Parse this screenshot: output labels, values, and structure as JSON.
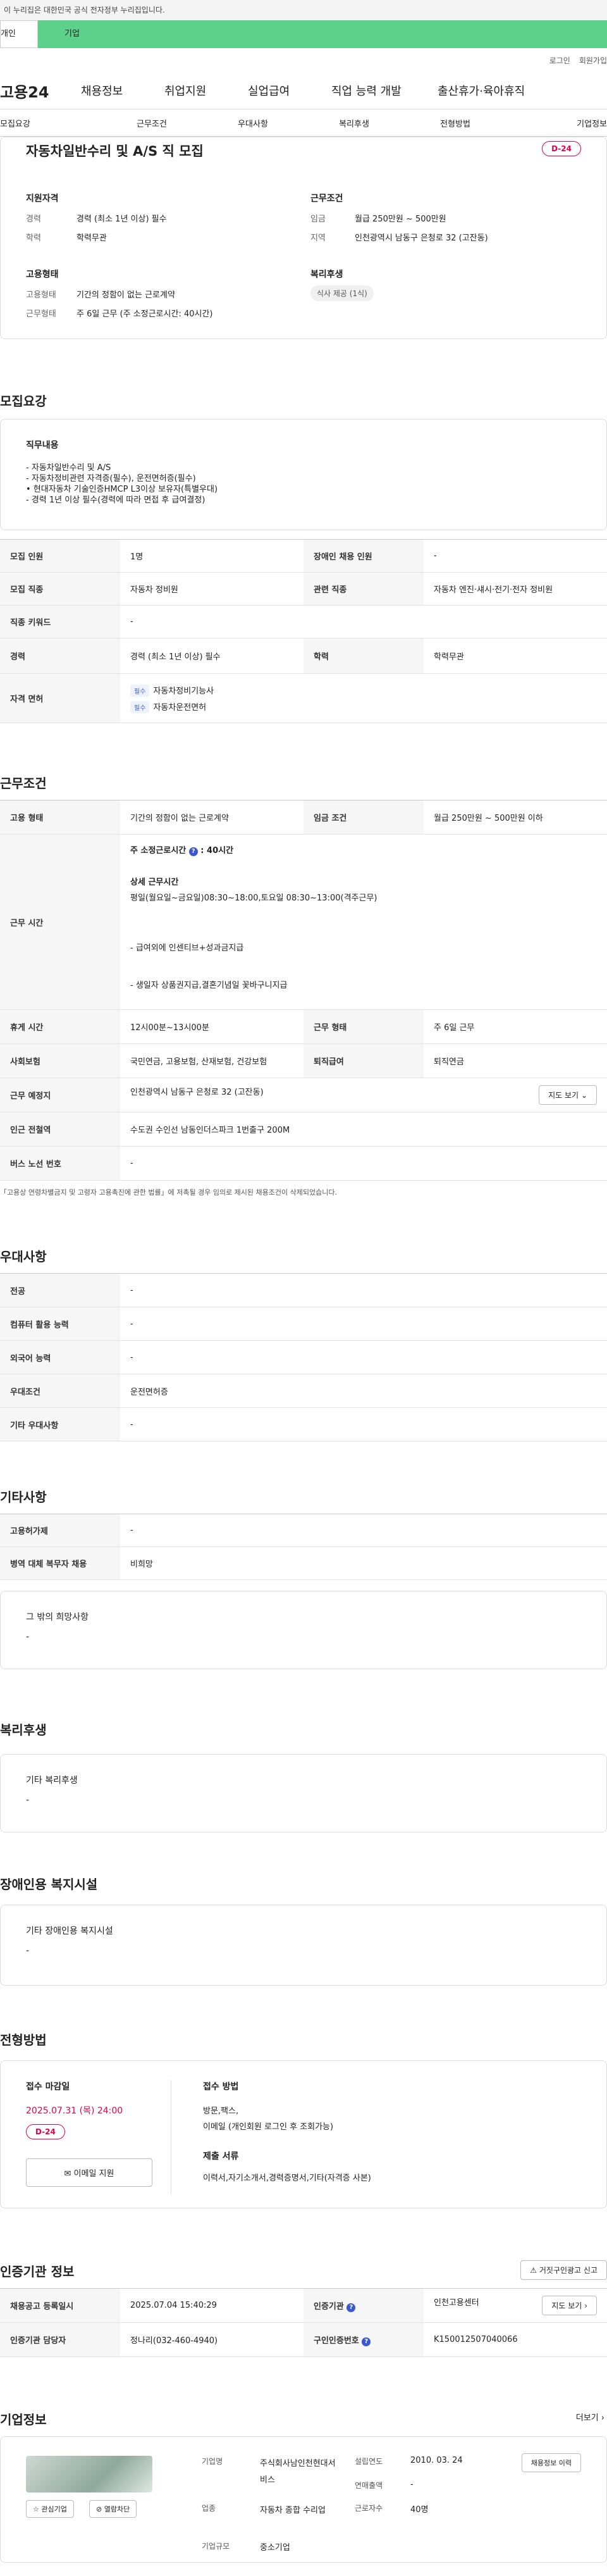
{
  "gov_banner": "이 누리집은 대한민국 공식 전자정부 누리집입니다.",
  "tabs": {
    "person": "개인",
    "business": "기업"
  },
  "util": {
    "login": "로그인",
    "join": "회원가입"
  },
  "logo": "고용24",
  "gnb": [
    "채용정보",
    "취업지원",
    "실업급여",
    "직업 능력 개발",
    "출산휴가·육아휴직"
  ],
  "tabbar": [
    "모집요강",
    "근무조건",
    "우대사항",
    "복리후생",
    "전형방법",
    "기업정보"
  ],
  "summary": {
    "title": "자동차일반수리 및 A/S 직 모집",
    "dday": "D-24",
    "qual_title": "지원자격",
    "career_label": "경력",
    "career": "경력 (최소 1년 이상) 필수",
    "edu_label": "학력",
    "edu": "학력무관",
    "cond_title": "근무조건",
    "wage_label": "임금",
    "wage": "월급 250만원 ~ 500만원",
    "region_label": "지역",
    "region": "인천광역시 남동구 은청로 32 (고잔동)",
    "emp_title": "고용형태",
    "emptype_label": "고용형태",
    "emptype": "기간의 정함이 없는 근로계약",
    "worktype_label": "근무형태",
    "worktype": "주 6일 근무 (주 소정근로시간: 40시간)",
    "welfare_title": "복리후생",
    "welfare_tag": "식사 제공 (1식)"
  },
  "recruit": {
    "title": "모집요강",
    "duty_title": "직무내용",
    "duty_lines": [
      "- 자동차일반수리 및 A/S",
      "- 자동차정비관련 자격증(필수), 운전면허증(필수)",
      "• 현대자동차 기술인증HMCP L3이상 보유자(특별우대)",
      "- 경력 1년 이상 필수(경력에 따라 면접 후 급여결정)"
    ],
    "rows": {
      "count_k": "모집 인원",
      "count_v": "1명",
      "dis_k": "장애인 채용 인원",
      "dis_v": "-",
      "job_k": "모집 직종",
      "job_v": "자동차 정비원",
      "rel_k": "관련 직종",
      "rel_v": "자동차 엔진·섀시·전기·전자 정비원",
      "kw_k": "직종 키워드",
      "kw_v": "-",
      "career_k": "경력",
      "career_v": "경력 (최소 1년 이상) 필수",
      "edu_k": "학력",
      "edu_v": "학력무관",
      "lic_k": "자격 면허",
      "lic_chip": "필수",
      "lic1": "자동차정비기능사",
      "lic2": "자동차운전면허"
    }
  },
  "work": {
    "title": "근무조건",
    "emp_k": "고용 형태",
    "emp_v": "기간의 정함이 없는 근로계약",
    "wage_k": "임금 조건",
    "wage_v": "월급 250만원 ~ 500만원 이하",
    "hours_k": "근무 시간",
    "hours_head": "주 소정근로시간",
    "hours_val": "40시간",
    "hours_sub": "상세 근무시간",
    "hours_detail": "평일(월요일~금요일)08:30~18:00,토요일 08:30~13:00(격주근무)",
    "extra1": "- 급여외에 인센티브+성과금지급",
    "extra2": "- 생일자 상품권지급,결혼기념일 꽃바구니지급",
    "break_k": "휴게 시간",
    "break_v": "12시00분~13시00분",
    "form_k": "근무 형태",
    "form_v": "주 6일 근무",
    "ins_k": "사회보험",
    "ins_v": "국민연금, 고용보험, 산재보험, 건강보험",
    "ret_k": "퇴직급여",
    "ret_v": "퇴직연금",
    "place_k": "근무 예정지",
    "place_v": "인천광역시 남동구 은청로 32 (고잔동)",
    "map": "지도 보기",
    "sub_k": "인근 전철역",
    "sub_v": "수도권 수인선 남동인더스파크 1번출구 200M",
    "bus_k": "버스 노선 번호",
    "bus_v": "-",
    "note": "「고용상 연령차별금지 및 고령자 고용촉진에 관한 법률」에 저촉될 경우 임의로 제시된 채용조건이 삭제되었습니다."
  },
  "pref": {
    "title": "우대사항",
    "major_k": "전공",
    "major_v": "-",
    "pc_k": "컴퓨터 활용 능력",
    "pc_v": "-",
    "lang_k": "외국어 능력",
    "lang_v": "-",
    "cond_k": "우대조건",
    "cond_v": "운전면허증",
    "etc_k": "기타 우대사항",
    "etc_v": "-"
  },
  "other": {
    "title": "기타사항",
    "disab_k": "고용허가제",
    "disab_v": "-",
    "mil_k": "병역 대체 복무자 채용",
    "mil_v": "비희망",
    "req_title": "그 밖의 희망사항",
    "req_v": "-"
  },
  "welfare": {
    "title": "복리후생",
    "sub": "기타 복리후생",
    "v": "-"
  },
  "facility": {
    "title": "장애인용 복지시설",
    "sub": "기타 장애인용 복지시설",
    "v": "-"
  },
  "apply": {
    "title": "전형방법",
    "deadline_t": "접수 마감일",
    "deadline": "2025.07.31 (목) 24:00",
    "dday": "D-24",
    "email_btn": "이메일 지원",
    "method_t": "접수 방법",
    "method1": "방문,팩스,",
    "method2": "이메일 (개인회원 로그인 후 조회가능)",
    "docs_t": "제출 서류",
    "docs": "이력서,자기소개서,경력증명서,기타(자격증 사본)"
  },
  "agency": {
    "title": "인증기관 정보",
    "report": "거짓구인광고 신고",
    "reg_k": "채용공고 등록일시",
    "reg_v": "2025.07.04 15:40:29",
    "ag_k": "인증기관",
    "ag_v": "인천고용센터",
    "map": "지도 보기",
    "mgr_k": "인증기관 담당자",
    "mgr_v": "정나리(032-460-4940)",
    "no_k": "구인인증번호",
    "no_v": "K150012507040066"
  },
  "company": {
    "title": "기업정보",
    "more": "더보기",
    "name_k": "기업명",
    "name_v": "주식회사남인천현대서비스",
    "est_k": "설립연도",
    "est_v": "2010. 03. 24",
    "hist_btn": "채용정보 이력",
    "ind_k": "업종",
    "ind_v": "자동차 종합 수리업",
    "rev_k": "연매출액",
    "rev_v": "-",
    "emp_k": "근로자수",
    "emp_v": "40명",
    "size_k": "기업규모",
    "size_v": "중소기업",
    "fav_btn": "관심기업",
    "block_btn": "열람차단"
  },
  "colors": {
    "accent": "#e0004d",
    "green": "#5dd08b",
    "blue": "#3957d0"
  }
}
